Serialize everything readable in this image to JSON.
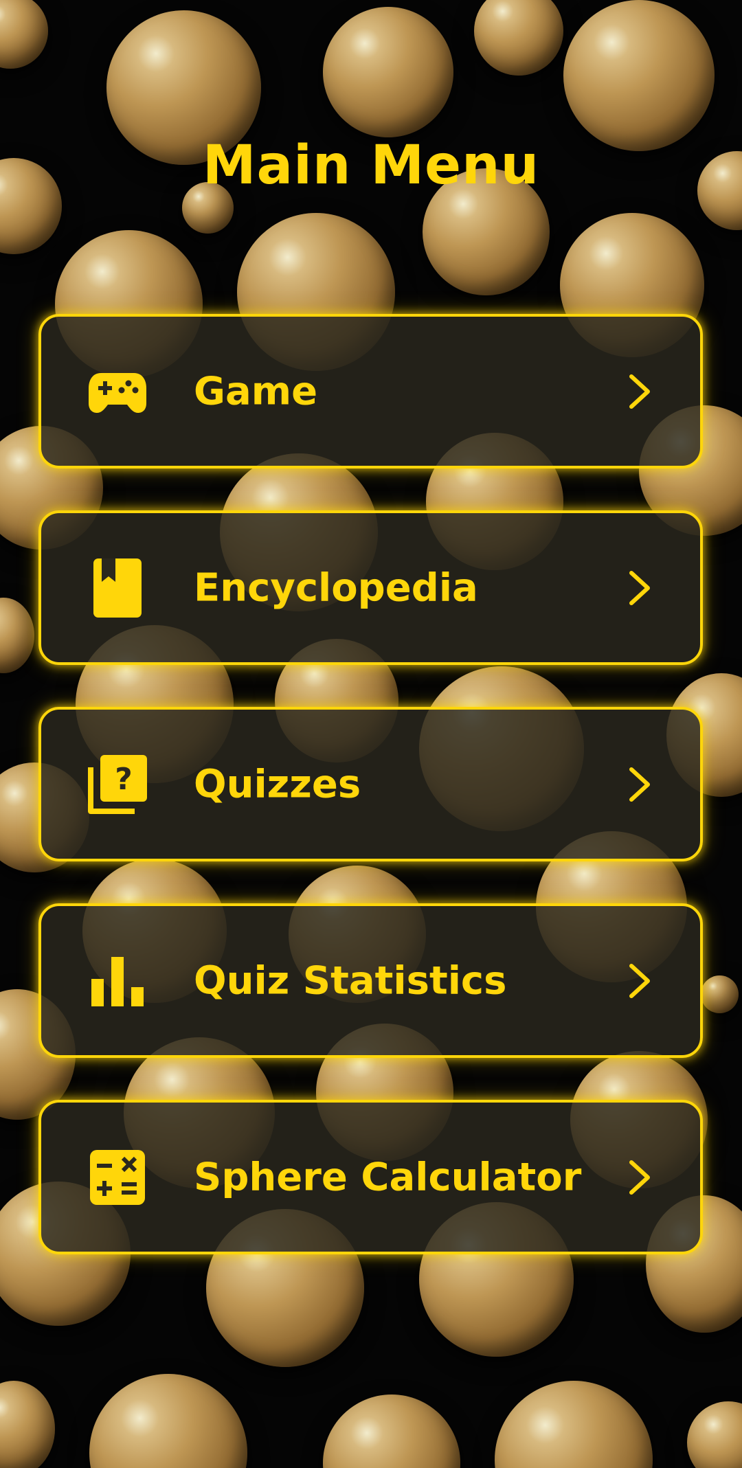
{
  "colors": {
    "accent": "#FFD60A",
    "background": "#050505",
    "card_fill": "#2B281E"
  },
  "header": {
    "title": "Main Menu"
  },
  "menu": {
    "items": [
      {
        "label": "Game",
        "icon": "gamepad-icon"
      },
      {
        "label": "Encyclopedia",
        "icon": "book-icon"
      },
      {
        "label": "Quizzes",
        "icon": "quiz-icon"
      },
      {
        "label": "Quiz Statistics",
        "icon": "bar-chart-icon"
      },
      {
        "label": "Sphere Calculator",
        "icon": "calculator-icon"
      }
    ],
    "chevron_icon": "chevron-right-icon"
  }
}
